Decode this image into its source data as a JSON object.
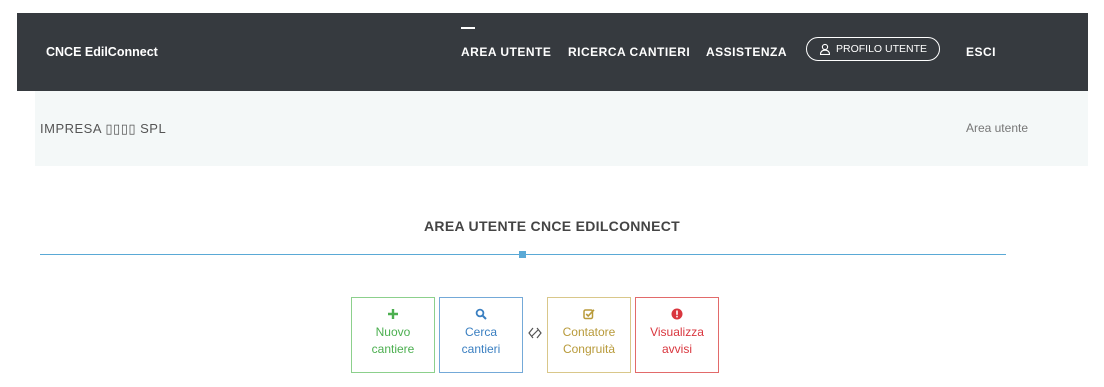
{
  "header": {
    "brand": "CNCE EdilConnect",
    "nav": {
      "area_utente": "AREA UTENTE",
      "ricerca_cantieri": "RICERCA CANTIERI",
      "assistenza": "ASSISTENZA",
      "profilo_utente": "PROFILO UTENTE",
      "esci": "ESCI"
    }
  },
  "breadcrumb_band": {
    "company": "IMPRESA ▯▯▯▯ SPL",
    "current_page": "Area utente"
  },
  "main": {
    "section_title": "AREA UTENTE CNCE EDILCONNECT",
    "cards": {
      "nuovo_cantiere": {
        "icon": "plus-icon",
        "label": "Nuovo\ncantiere"
      },
      "cerca_cantieri": {
        "icon": "search-icon",
        "label": "Cerca\ncantieri"
      },
      "contatore_congruita": {
        "icon": "checkbox-icon",
        "label": "Contatore\nCongruità"
      },
      "visualizza_avvisi": {
        "icon": "alert-icon",
        "label": "Visualizza\navvisi"
      }
    }
  },
  "colors": {
    "header_bg": "#363a3f",
    "band_bg": "#f4f8f8",
    "accent_blue": "#5aa9d6",
    "green": "#4caf50",
    "blue": "#3a7fc1",
    "yellow": "#b89a3a",
    "red": "#d9363e"
  }
}
